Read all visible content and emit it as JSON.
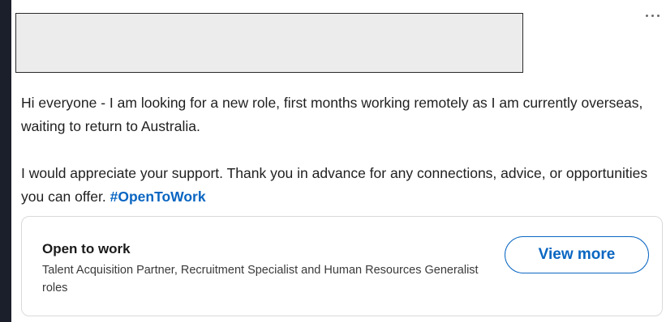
{
  "post": {
    "paragraph1": "Hi everyone - I am looking for a new role, first months working remotely as I am currently overseas, waiting to return to Australia.",
    "paragraph2_text": "I would appreciate your support. Thank you in advance for any connections, advice, or opportunities you can offer. ",
    "hashtag": "#OpenToWork"
  },
  "open_to_work_card": {
    "title": "Open to work",
    "roles": "Talent Acquisition Partner, Recruitment Specialist and Human Resources Generalist roles",
    "button_label": "View more"
  },
  "icons": {
    "more_menu": "more-horizontal-icon"
  },
  "colors": {
    "page_background": "#1b1f2b",
    "card_background": "#ffffff",
    "redacted_box": "#ececec",
    "link_blue": "#0a66c2",
    "text_primary": "#1f1f1f"
  }
}
